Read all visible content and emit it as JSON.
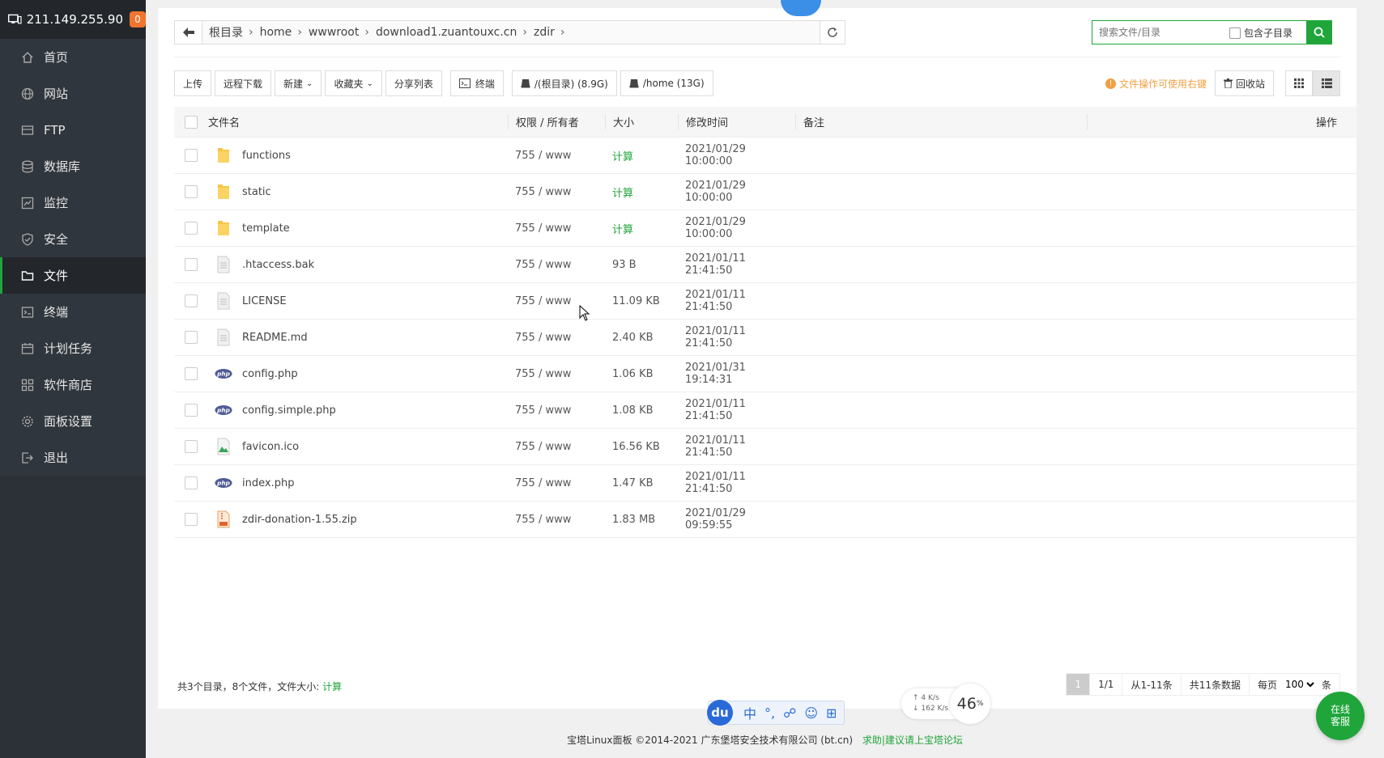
{
  "server": {
    "ip": "211.149.255.90",
    "badge": "0"
  },
  "sidebar": {
    "items": [
      {
        "label": "首页",
        "icon": "home-icon"
      },
      {
        "label": "网站",
        "icon": "globe-icon"
      },
      {
        "label": "FTP",
        "icon": "ftp-icon"
      },
      {
        "label": "数据库",
        "icon": "database-icon"
      },
      {
        "label": "监控",
        "icon": "monitor-chart-icon"
      },
      {
        "label": "安全",
        "icon": "shield-icon"
      },
      {
        "label": "文件",
        "icon": "folder-icon",
        "active": true
      },
      {
        "label": "终端",
        "icon": "terminal-icon"
      },
      {
        "label": "计划任务",
        "icon": "calendar-icon"
      },
      {
        "label": "软件商店",
        "icon": "apps-icon"
      },
      {
        "label": "面板设置",
        "icon": "gear-icon"
      },
      {
        "label": "退出",
        "icon": "logout-icon"
      }
    ]
  },
  "breadcrumb": [
    "根目录",
    "home",
    "wwwroot",
    "download1.zuantouxc.cn",
    "zdir"
  ],
  "search": {
    "placeholder": "搜索文件/目录",
    "subdir_label": "包含子目录"
  },
  "toolbar": {
    "upload": "上传",
    "remote_download": "远程下载",
    "new": "新建",
    "favorites": "收藏夹",
    "share_list": "分享列表",
    "terminal": "终端",
    "disk_root": "/(根目录) (8.9G)",
    "disk_home": "/home (13G)",
    "hint": "文件操作可使用右键",
    "recycle": "回收站"
  },
  "table": {
    "headers": {
      "name": "文件名",
      "perm": "权限 / 所有者",
      "size": "大小",
      "mtime": "修改时间",
      "note": "备注",
      "op": "操作"
    },
    "rows": [
      {
        "name": "functions",
        "type": "folder",
        "perm": "755 / www",
        "size": "计算",
        "calc": true,
        "mtime": "2021/01/29 10:00:00"
      },
      {
        "name": "static",
        "type": "folder",
        "perm": "755 / www",
        "size": "计算",
        "calc": true,
        "mtime": "2021/01/29 10:00:00"
      },
      {
        "name": "template",
        "type": "folder",
        "perm": "755 / www",
        "size": "计算",
        "calc": true,
        "mtime": "2021/01/29 10:00:00"
      },
      {
        "name": ".htaccess.bak",
        "type": "text",
        "perm": "755 / www",
        "size": "93 B",
        "mtime": "2021/01/11 21:41:50"
      },
      {
        "name": "LICENSE",
        "type": "text",
        "perm": "755 / www",
        "size": "11.09 KB",
        "mtime": "2021/01/11 21:41:50"
      },
      {
        "name": "README.md",
        "type": "text",
        "perm": "755 / www",
        "size": "2.40 KB",
        "mtime": "2021/01/11 21:41:50"
      },
      {
        "name": "config.php",
        "type": "php",
        "perm": "755 / www",
        "size": "1.06 KB",
        "mtime": "2021/01/31 19:14:31"
      },
      {
        "name": "config.simple.php",
        "type": "php",
        "perm": "755 / www",
        "size": "1.08 KB",
        "mtime": "2021/01/11 21:41:50"
      },
      {
        "name": "favicon.ico",
        "type": "image",
        "perm": "755 / www",
        "size": "16.56 KB",
        "mtime": "2021/01/11 21:41:50"
      },
      {
        "name": "index.php",
        "type": "php",
        "perm": "755 / www",
        "size": "1.47 KB",
        "mtime": "2021/01/11 21:41:50"
      },
      {
        "name": "zdir-donation-1.55.zip",
        "type": "zip",
        "perm": "755 / www",
        "size": "1.83 MB",
        "mtime": "2021/01/29 09:59:55"
      }
    ]
  },
  "stats": {
    "summary": "共3个目录，8个文件，文件大小:",
    "calc": "计算"
  },
  "pager": {
    "current": "1",
    "pages": "1/1",
    "range": "从1-11条",
    "total": "共11条数据",
    "per_page_label": "每页",
    "per_page": "100",
    "unit": "条"
  },
  "footer": {
    "copyright": "宝塔Linux面板 ©2014-2021 广东堡塔安全技术有限公司 (bt.cn)",
    "link": "求助|建议请上宝塔论坛"
  },
  "ime": {
    "du": "du",
    "lang": "中"
  },
  "net": {
    "up": "4",
    "up_unit": "K/s",
    "down": "162",
    "down_unit": "K/s",
    "load": "46",
    "load_unit": "%"
  },
  "service": {
    "line1": "在线",
    "line2": "客服"
  },
  "colors": {
    "accent": "#20a53a",
    "sidebar": "#2c3138",
    "warn": "#f0a043"
  }
}
